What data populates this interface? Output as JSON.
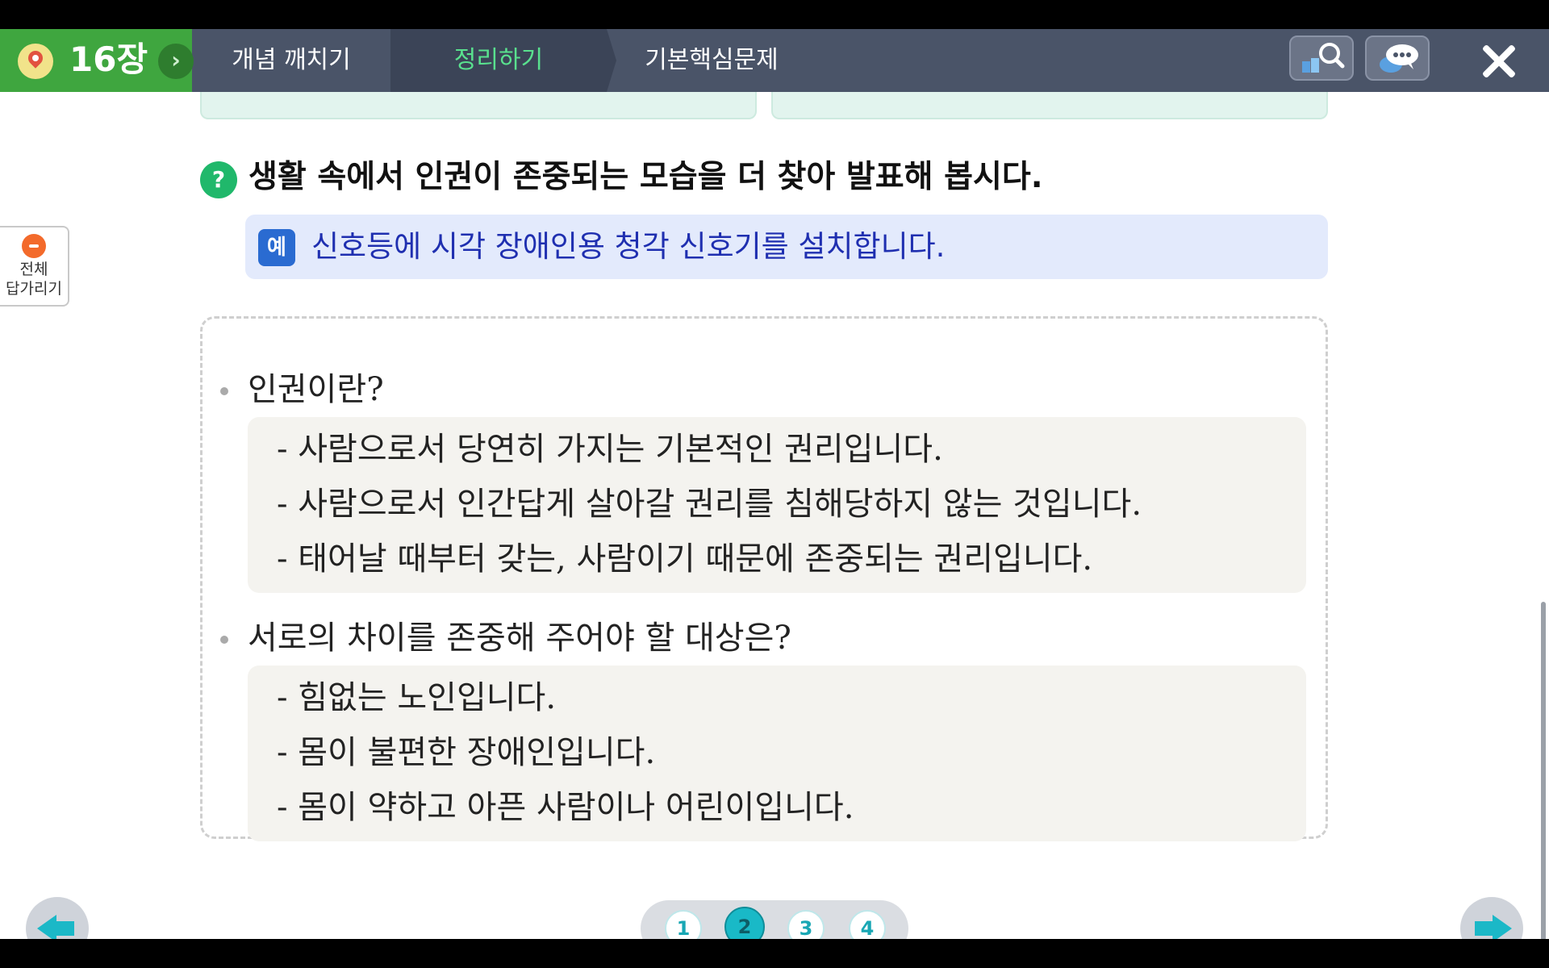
{
  "topbar": {
    "chapter_label": "16장",
    "tabs": [
      {
        "label": "개념 깨치기",
        "active": false
      },
      {
        "label": "정리하기",
        "active": true
      },
      {
        "label": "기본핵심문제",
        "active": false
      }
    ],
    "tools": [
      "search-book-icon",
      "chat-icon"
    ]
  },
  "side": {
    "toggle_line1": "전체",
    "toggle_line2": "답가리기"
  },
  "question": {
    "badge": "?",
    "text": "생활 속에서 인권이 존중되는 모습을 더 찾아 발표해 봅시다.",
    "example_badge": "예",
    "example_text": "신호등에 시각 장애인용 청각 신호기를 설치합니다."
  },
  "summary": {
    "sections": [
      {
        "heading": "인권이란?",
        "answers": [
          "- 사람으로서 당연히 가지는 기본적인 권리입니다.",
          "- 사람으로서 인간답게 살아갈 권리를 침해당하지 않는 것입니다.",
          "- 태어날 때부터 갖는, 사람이기 때문에 존중되는 권리입니다."
        ]
      },
      {
        "heading": "서로의 차이를 존중해 주어야 할 대상은?",
        "answers": [
          "- 힘없는 노인입니다.",
          "- 몸이 불편한 장애인입니다.",
          "- 몸이 약하고 아픈 사람이나 어린이입니다."
        ]
      }
    ]
  },
  "pager": {
    "pages": [
      "1",
      "2",
      "3",
      "4"
    ],
    "current": "2"
  },
  "colors": {
    "accent_green": "#3fa63f",
    "active_tab_text": "#59e08e",
    "example_text": "#1f2fb0",
    "nav_arrow": "#1bb8c7"
  }
}
